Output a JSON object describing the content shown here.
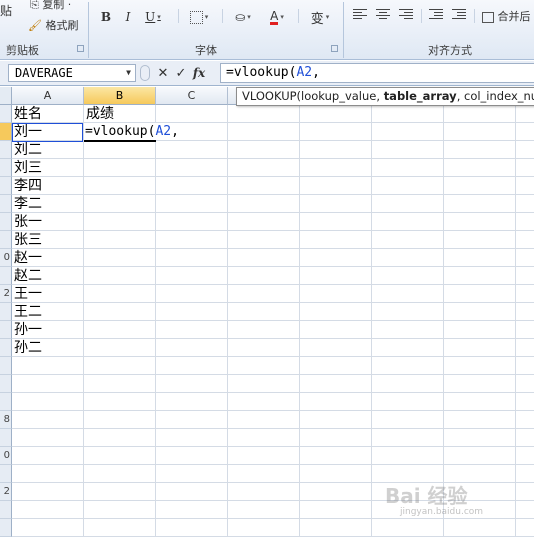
{
  "ribbon": {
    "clipboard": {
      "paste_label": "贴",
      "copy_label": "复制 ·",
      "format_painter_label": "格式刷",
      "group_label": "剪贴板"
    },
    "font": {
      "bold": "B",
      "italic": "I",
      "underline": "U",
      "font_color": "A",
      "phonetic": "变",
      "group_label": "字体"
    },
    "alignment": {
      "merge_label": "合并后",
      "group_label": "对齐方式"
    }
  },
  "formula_bar": {
    "name_box": "DAVERAGE",
    "cancel": "✕",
    "enter": "✓",
    "fx": "fx",
    "formula_prefix": "=vlookup(",
    "formula_ref": "A2",
    "formula_suffix": ","
  },
  "tooltip": {
    "prefix": "VLOOKUP(lookup_value, ",
    "bold_arg": "table_array",
    "suffix": ", col_index_num"
  },
  "sheet": {
    "columns": [
      "A",
      "B",
      "C"
    ],
    "row_numbers": [
      "",
      "",
      "",
      "",
      "",
      "",
      "",
      "",
      "0",
      "",
      "2",
      "",
      "",
      "",
      "",
      "",
      "",
      "8",
      "",
      "0",
      "",
      "2",
      "",
      ""
    ],
    "header_a": "姓名",
    "header_b": "成绩",
    "names": [
      "刘一",
      "刘二",
      "刘三",
      "李四",
      "李二",
      "张一",
      "张三",
      "赵一",
      "赵二",
      "王一",
      "王二",
      "孙一",
      "孙二"
    ],
    "edit_prefix": "=vlookup(",
    "edit_ref": "A2",
    "edit_suffix": ","
  },
  "watermark": {
    "main": "Bai 经验",
    "sub": "jingyan.baidu.com"
  }
}
